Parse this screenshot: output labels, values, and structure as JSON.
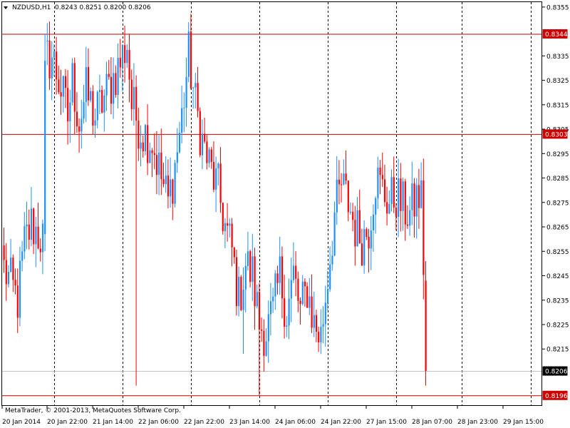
{
  "window": {
    "symbol_title": "NZDUSD,H1",
    "ohlc_readout": "0.8243 0.8251 0.8200 0.8206",
    "copyright": "MetaTrader, © 2001-2013, MetaQuotes Software Corp."
  },
  "colors": {
    "bull": "#1e90ff",
    "bear": "#ff0000",
    "level_line": "#cc0000",
    "current_line": "#c0c0c0",
    "grid": "#000000",
    "frame": "#000000"
  },
  "icons": {
    "menu": "triangle-down-icon"
  },
  "chart_data": {
    "type": "candlestick",
    "y_axis": {
      "ticks": [
        "0.8355",
        "0.8335",
        "0.8325",
        "0.8315",
        "0.8305",
        "0.8295",
        "0.8285",
        "0.8275",
        "0.8265",
        "0.8255",
        "0.8245",
        "0.8235",
        "0.8225",
        "0.8215"
      ],
      "range": [
        0.8192,
        0.8357
      ]
    },
    "x_axis": {
      "ticks": [
        "20 Jan 2014",
        "20 Jan 22:00",
        "21 Jan 14:00",
        "22 Jan 06:00",
        "22 Jan 22:00",
        "23 Jan 14:00",
        "24 Jan 06:00",
        "24 Jan 22:00",
        "27 Jan 15:00",
        "28 Jan 07:00",
        "28 Jan 23:00",
        "29 Jan 15:00"
      ],
      "separators": [
        "20 Jan 22:00",
        "21 Jan 14:00",
        "22 Jan 06:00",
        "22 Jan 22:00",
        "23 Jan 14:00",
        "24 Jan 06:00",
        "24 Jan 22:00",
        "27 Jan 15:00",
        "28 Jan 07:00",
        "28 Jan 23:00",
        "29 Jan 15:00"
      ]
    },
    "levels": [
      {
        "name": "resistance-high",
        "value": "0.8344"
      },
      {
        "name": "resistance-mid",
        "value": "0.8303"
      },
      {
        "name": "support-low",
        "value": "0.8196"
      }
    ],
    "current_price": "0.8206",
    "anchors": [
      [
        0,
        0.8248
      ],
      [
        6,
        0.8235
      ],
      [
        9,
        0.8258
      ],
      [
        12,
        0.8266
      ],
      [
        15,
        0.8262
      ],
      [
        17,
        0.826
      ],
      [
        18,
        0.8333
      ],
      [
        21,
        0.8335
      ],
      [
        24,
        0.8325
      ],
      [
        28,
        0.831
      ],
      [
        30,
        0.8325
      ],
      [
        33,
        0.8308
      ],
      [
        36,
        0.832
      ],
      [
        40,
        0.831
      ],
      [
        45,
        0.832
      ],
      [
        50,
        0.833
      ],
      [
        54,
        0.834
      ],
      [
        56,
        0.8315
      ],
      [
        60,
        0.8305
      ],
      [
        65,
        0.83
      ],
      [
        69,
        0.8285
      ],
      [
        72,
        0.8275
      ],
      [
        75,
        0.829
      ],
      [
        78,
        0.831
      ],
      [
        81,
        0.8335
      ],
      [
        84,
        0.8315
      ],
      [
        87,
        0.83
      ],
      [
        90,
        0.829
      ],
      [
        94,
        0.828
      ],
      [
        97,
        0.8265
      ],
      [
        100,
        0.8255
      ],
      [
        103,
        0.8235
      ],
      [
        106,
        0.825
      ],
      [
        109,
        0.8245
      ],
      [
        112,
        0.8225
      ],
      [
        115,
        0.8222
      ],
      [
        118,
        0.823
      ],
      [
        121,
        0.8245
      ],
      [
        124,
        0.823
      ],
      [
        127,
        0.8245
      ],
      [
        130,
        0.823
      ],
      [
        133,
        0.824
      ],
      [
        136,
        0.8225
      ],
      [
        139,
        0.822
      ],
      [
        142,
        0.8245
      ],
      [
        145,
        0.827
      ],
      [
        148,
        0.8282
      ],
      [
        151,
        0.8275
      ],
      [
        154,
        0.8265
      ],
      [
        157,
        0.826
      ],
      [
        160,
        0.8265
      ],
      [
        163,
        0.8285
      ],
      [
        166,
        0.828
      ],
      [
        169,
        0.8275
      ],
      [
        172,
        0.8278
      ],
      [
        175,
        0.8273
      ],
      [
        178,
        0.827
      ],
      [
        181,
        0.8277
      ],
      [
        183,
        0.8277
      ],
      [
        184,
        0.825
      ],
      [
        185,
        0.8206
      ]
    ],
    "last_candle": {
      "open": 0.8243,
      "high": 0.8251,
      "low": 0.82,
      "close": 0.8206
    }
  }
}
